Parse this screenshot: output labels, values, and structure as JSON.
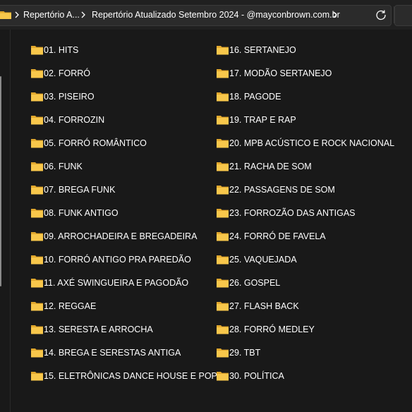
{
  "address_bar": {
    "breadcrumbs": [
      "Repertório A...",
      "Repertório Atualizado Setembro 2024 - @mayconbrown.com.br"
    ]
  },
  "icons": {
    "folder": "folder-icon",
    "chevron": "chevron-right-icon",
    "refresh": "refresh-icon"
  },
  "colors": {
    "folder_yellow": "#f8c74b",
    "folder_dark": "#e2a82d",
    "background": "#191919"
  },
  "folders_col1": [
    "01. HITS",
    "02. FORRÓ",
    "03. PISEIRO",
    "04. FORROZIN",
    "05. FORRÓ ROMÂNTICO",
    "06. FUNK",
    "07. BREGA FUNK",
    "08. FUNK ANTIGO",
    "09. ARROCHADEIRA E BREGADEIRA",
    "10. FORRÓ ANTIGO PRA PAREDÃO",
    "11. AXÉ SWINGUEIRA E PAGODÃO",
    "12. REGGAE",
    "13. SERESTA E ARROCHA",
    "14. BREGA E SERESTAS ANTIGA",
    "15. ELETRÔNICAS DANCE HOUSE E POP"
  ],
  "folders_col2": [
    "16. SERTANEJO",
    "17. MODÃO SERTANEJO",
    "18. PAGODE",
    "19. TRAP E RAP",
    "20. MPB ACÚSTICO E ROCK NACIONAL",
    "21. RACHA DE SOM",
    "22. PASSAGENS DE SOM",
    "23. FORROZÃO DAS ANTIGAS",
    "24. FORRÓ DE FAVELA",
    "25. VAQUEJADA",
    "26. GOSPEL",
    "27. FLASH BACK",
    "28. FORRÓ MEDLEY",
    "29. TBT",
    "30. POLÍTICA"
  ]
}
